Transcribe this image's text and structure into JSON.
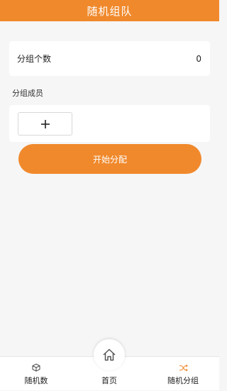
{
  "header": {
    "title": "随机组队"
  },
  "group_count": {
    "label": "分组个数",
    "value": "0"
  },
  "members": {
    "label": "分组成员"
  },
  "actions": {
    "start_label": "开始分配"
  },
  "tabbar": {
    "items": [
      {
        "label": "随机数",
        "icon": "cube-icon"
      },
      {
        "label": "首页",
        "icon": "home-icon"
      },
      {
        "label": "随机分组",
        "icon": "shuffle-icon"
      }
    ]
  },
  "colors": {
    "accent": "#f0892c",
    "background": "#f6f6f6"
  }
}
